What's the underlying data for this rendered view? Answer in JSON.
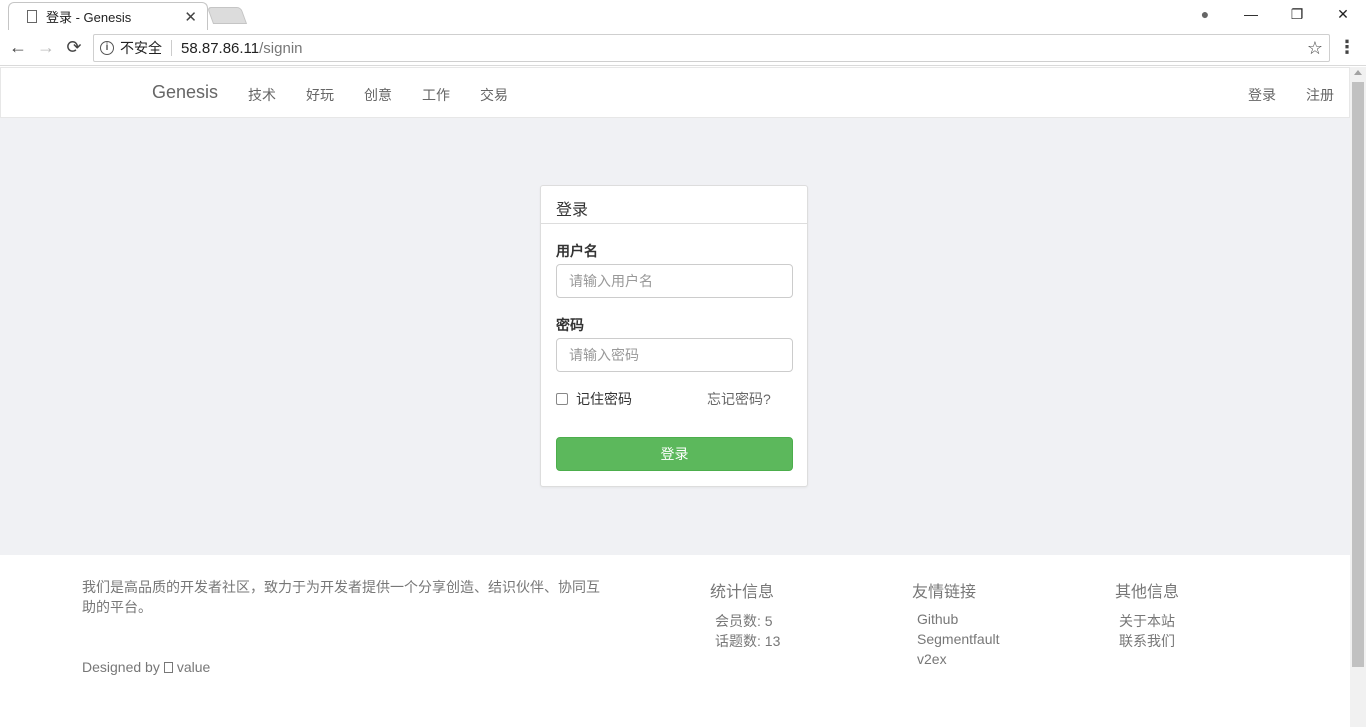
{
  "browser": {
    "tab_title": "登录 - Genesis",
    "tab_close": "✕",
    "insecure_label": "不安全",
    "url_host": "58.87.86.11",
    "url_path": "/signin",
    "back": "←",
    "forward": "→",
    "reload": "⟳",
    "star": "☆",
    "menu": "⋮",
    "minimize": "—",
    "restore": "❐",
    "close": "✕",
    "account": "●"
  },
  "navbar": {
    "brand": "Genesis",
    "links": [
      "技术",
      "好玩",
      "创意",
      "工作",
      "交易"
    ],
    "signin": "登录",
    "signup": "注册"
  },
  "login": {
    "title": "登录",
    "username_label": "用户名",
    "username_placeholder": "请输入用户名",
    "password_label": "密码",
    "password_placeholder": "请输入密码",
    "remember": "记住密码",
    "forgot": "忘记密码?",
    "submit": "登录"
  },
  "footer": {
    "about": "我们是高品质的开发者社区，致力于为开发者提供一个分享创造、结识伙伴、协同互助的平台。",
    "designed_prefix": "Designed by",
    "designed_suffix": "value",
    "stats": {
      "title": "统计信息",
      "members": "会员数: 5",
      "topics": "话题数: 13"
    },
    "links": {
      "title": "友情链接",
      "items": [
        "Github",
        "Segmentfault",
        "v2ex"
      ]
    },
    "other": {
      "title": "其他信息",
      "items": [
        "关于本站",
        "联系我们"
      ]
    }
  }
}
